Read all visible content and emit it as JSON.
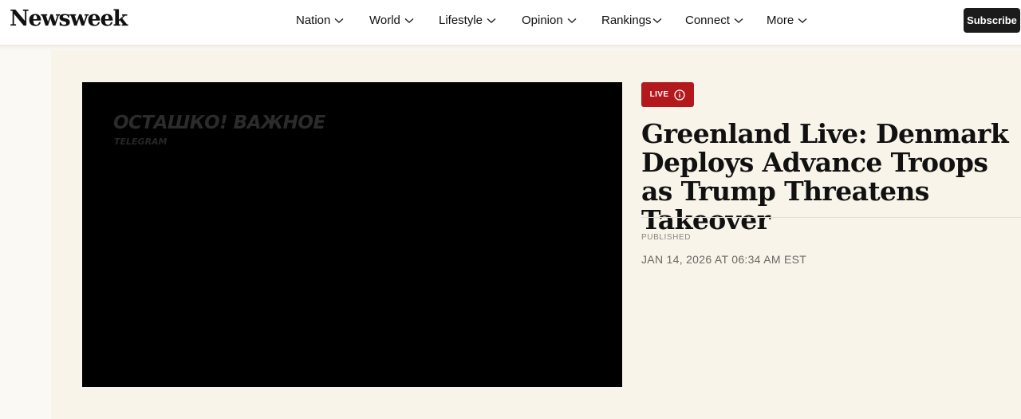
{
  "header": {
    "logo": "Newsweek",
    "nav": [
      {
        "label": "Nation"
      },
      {
        "label": "World"
      },
      {
        "label": "Lifestyle"
      },
      {
        "label": "Opinion"
      },
      {
        "label": "Rankings"
      },
      {
        "label": "Connect"
      },
      {
        "label": "More"
      }
    ],
    "subscribe_label": "Subscribe"
  },
  "video": {
    "overlay_title": "ОСТАШКО! ВАЖНОЕ",
    "overlay_source": "TELEGRAM"
  },
  "article": {
    "live_label": "LIVE",
    "live_icon": "info-icon",
    "headline": "Greenland Live: Denmark Deploys Advance Troops as Trump Threatens Takeover",
    "published_label": "PUBLISHED",
    "published_date": "JAN 14, 2026 AT 06:34 AM EST"
  },
  "colors": {
    "accent_live": "#b3181c",
    "page_bg": "#f8f4ea",
    "subscribe_bg": "#1b1b1b"
  }
}
